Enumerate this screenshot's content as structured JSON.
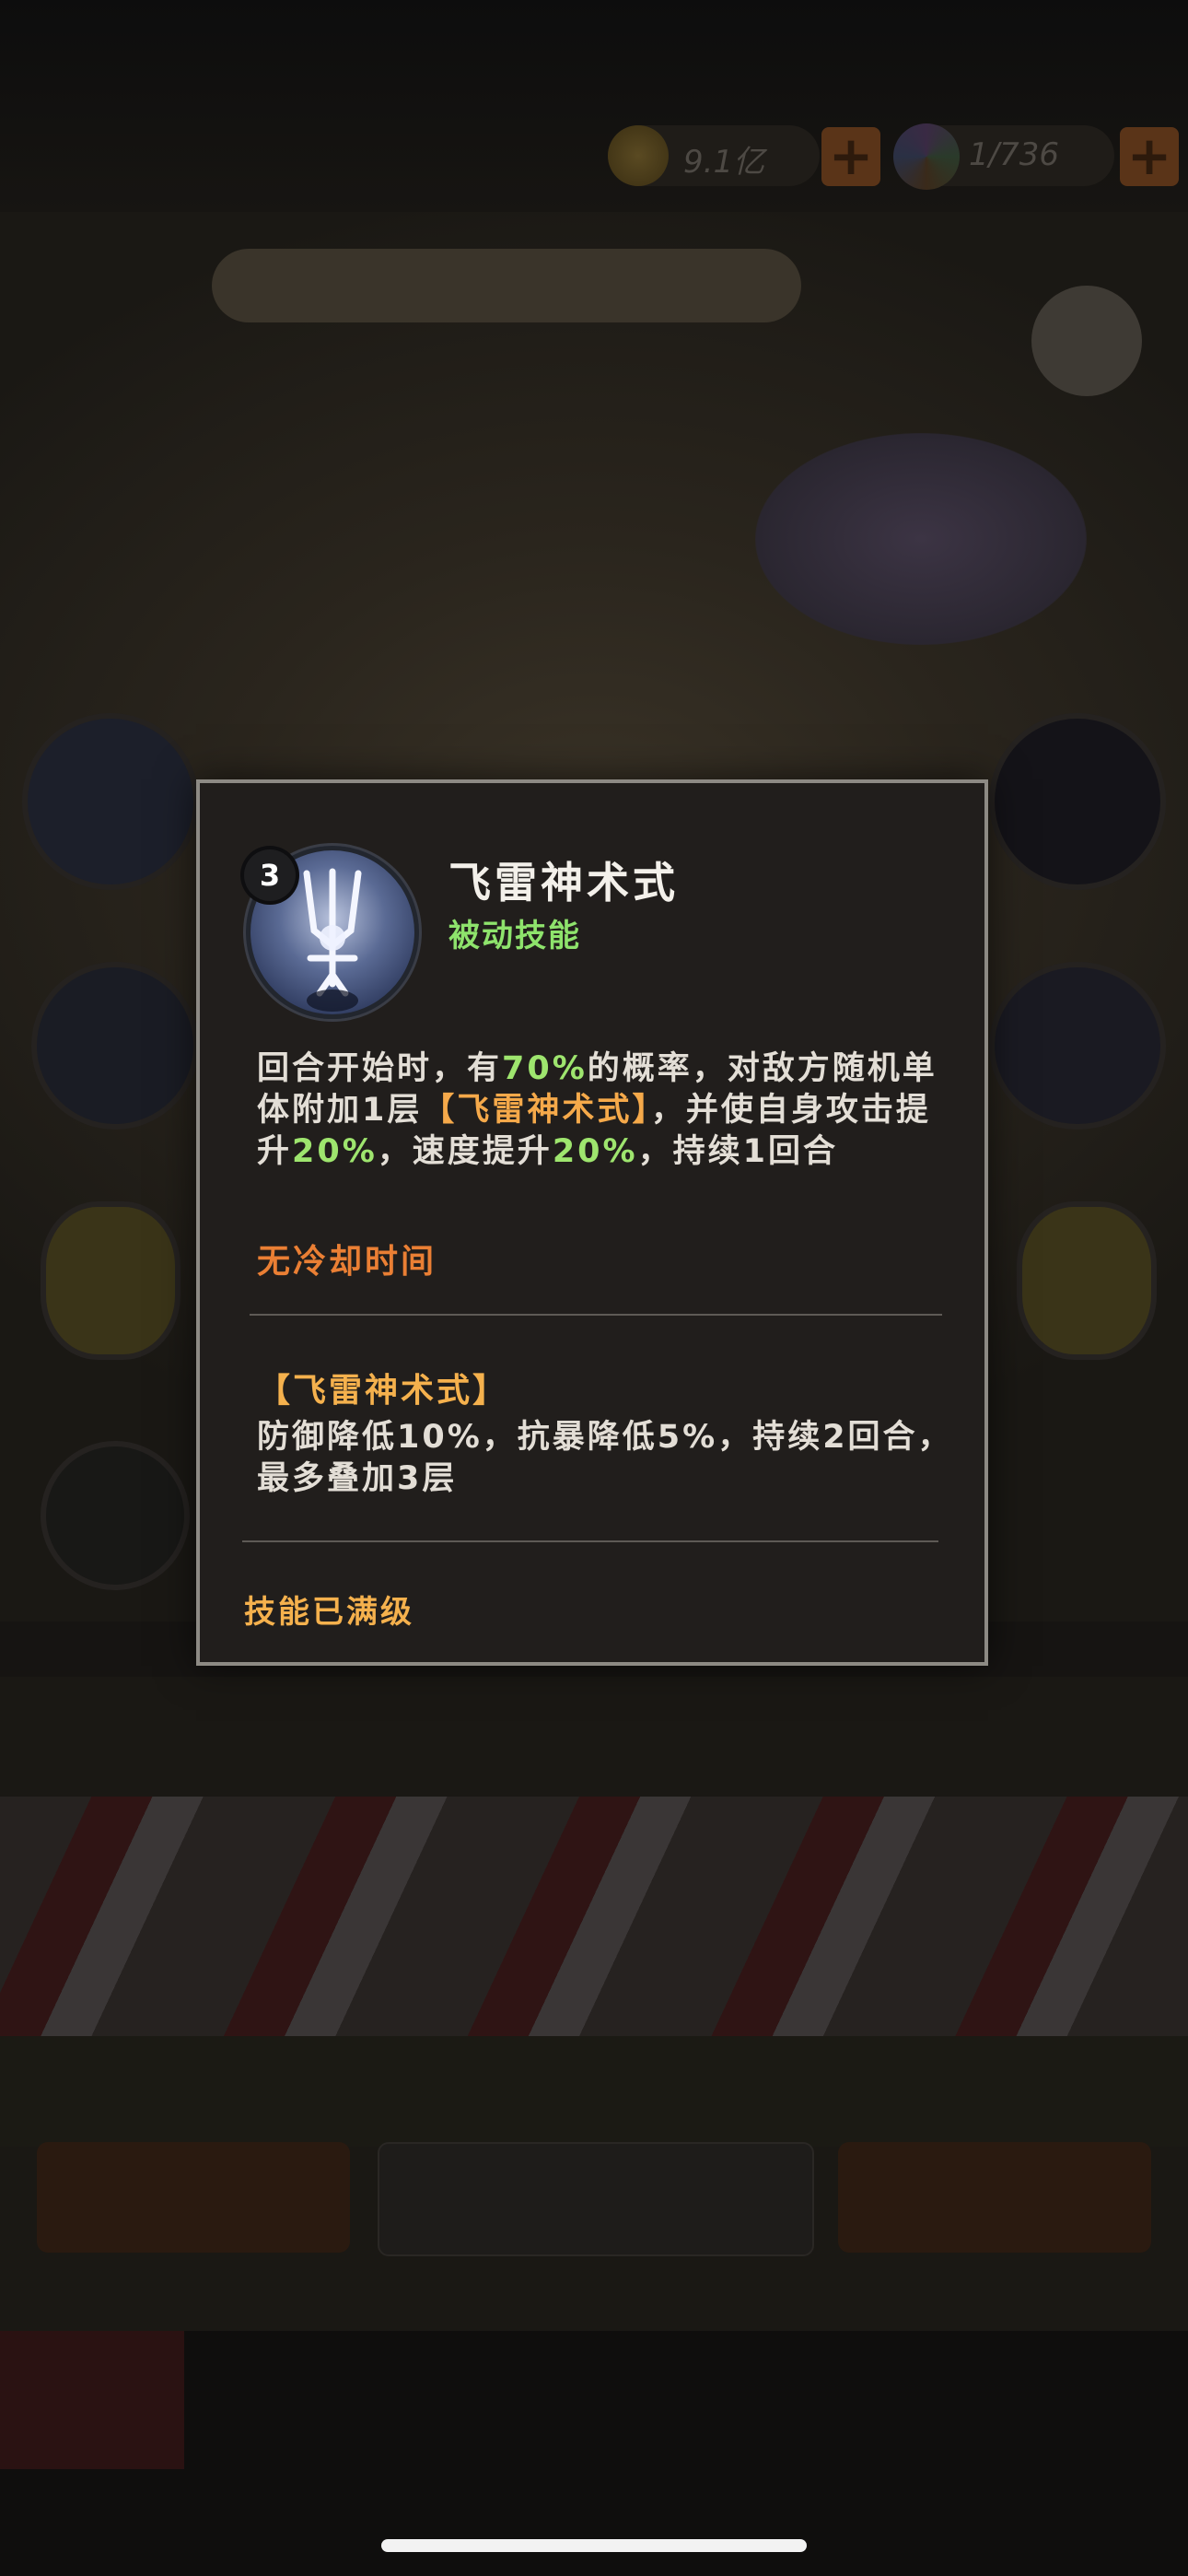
{
  "resources": {
    "coins_value": "9.1亿",
    "gems_value": "1/736"
  },
  "skill": {
    "level": "3",
    "name": "飞雷神术式",
    "type": "被动技能",
    "description": {
      "p1": "回合开始时，有",
      "chance": "70%",
      "p2": "的概率，对敌方随机单体附加1层",
      "effect_ref": "【飞雷神术式】",
      "p3": "，并使自身攻击提升",
      "atk_up": "20%",
      "p4": "，速度提升",
      "spd_up": "20%",
      "p5": "，持续1回合"
    },
    "cooldown": "无冷却时间"
  },
  "effect": {
    "title": "【飞雷神术式】",
    "description": "防御降低10%，抗暴降低5%，持续2回合，最多叠加3层"
  },
  "footer": {
    "status": "技能已满级"
  },
  "colors": {
    "highlight_green": "#9ee56e",
    "highlight_orange": "#f5a94a",
    "cooldown_orange": "#ea7f34",
    "popup_border": "#8d8a84"
  }
}
